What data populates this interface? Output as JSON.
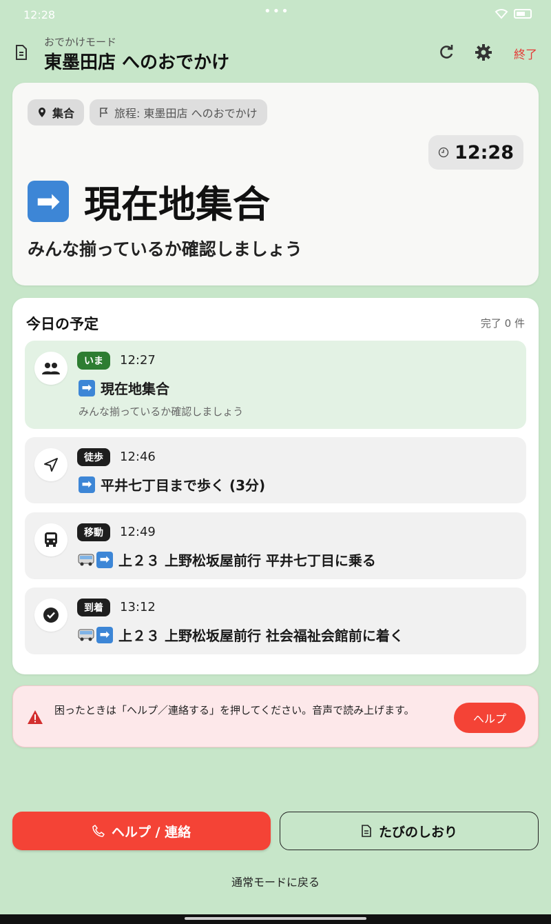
{
  "status_bar": {
    "time": "12:28",
    "dots": "•••"
  },
  "header": {
    "subtitle": "おでかけモード",
    "title": "東墨田店 へのおでかけ",
    "end_label": "終了"
  },
  "hero": {
    "chip_gather": "集合",
    "chip_trip": "旅程: 東墨田店 へのおでかけ",
    "clock": "12:28",
    "arrow": "➡",
    "title": "現在地集合",
    "subtitle": "みんな揃っているか確認しましょう"
  },
  "schedule": {
    "title": "今日の予定",
    "done_count": "完了 0 件",
    "items": [
      {
        "badge": "いま",
        "time": "12:27",
        "title": "現在地集合",
        "note": "みんな揃っているか確認しましょう",
        "icon": "group-icon"
      },
      {
        "badge": "徒歩",
        "time": "12:46",
        "title": "平井七丁目まで歩く (3分)",
        "icon": "navigation-arrow-icon"
      },
      {
        "badge": "移動",
        "time": "12:49",
        "title": "上２３ 上野松坂屋前行 平井七丁目に乗る",
        "icon": "bus-icon"
      },
      {
        "badge": "到着",
        "time": "13:12",
        "title": "上２３ 上野松坂屋前行 社会福祉会館前に着く",
        "icon": "check-circle-icon"
      }
    ]
  },
  "alert": {
    "text": "困ったときは「ヘルプ／連絡する」を押してください。音声で読み上げます。",
    "help_label": "ヘルプ"
  },
  "footer": {
    "help_contact_label": "ヘルプ / 連絡",
    "guide_label": "たびのしおり",
    "back_label": "通常モードに戻る"
  },
  "colors": {
    "background": "#c7e6c9",
    "accent_red": "#f44336",
    "current_green": "#2e7d32",
    "current_item_bg": "#e3f2e4"
  }
}
